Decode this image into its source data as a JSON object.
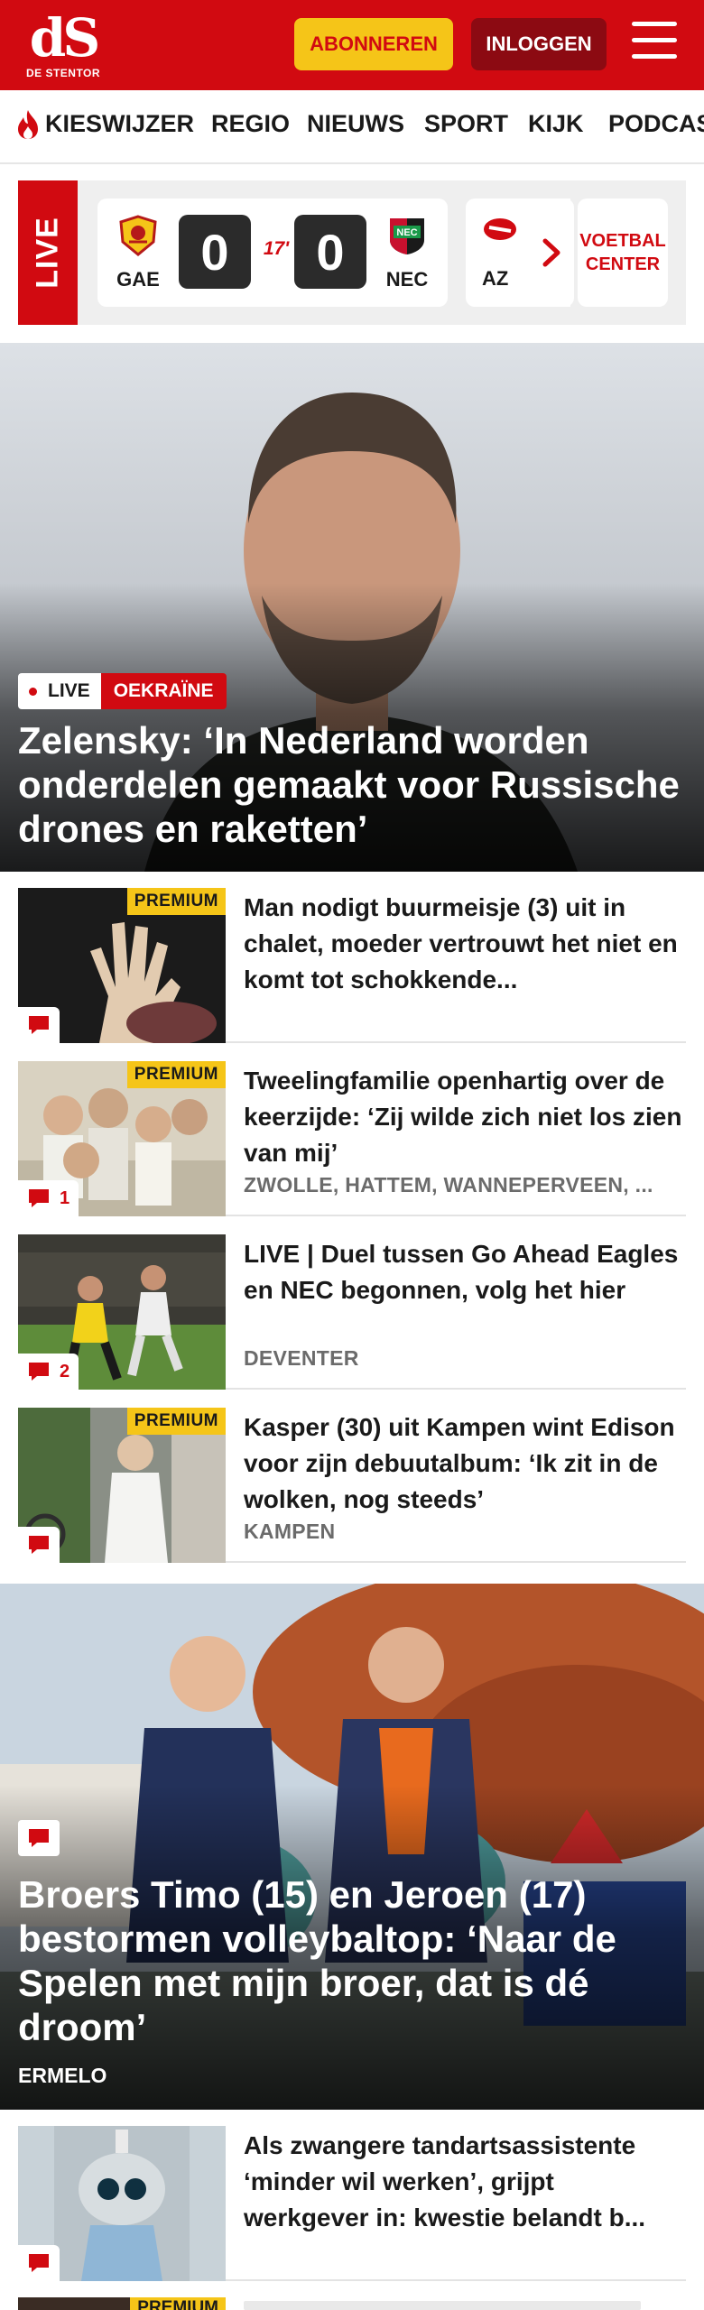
{
  "header": {
    "logo_mark": "dS",
    "logo_sub": "DE STENTOR",
    "subscribe_label": "ABONNEREN",
    "login_label": "INLOGGEN"
  },
  "nav": {
    "items": [
      "KIESWIJZER",
      "REGIO",
      "NIEUWS",
      "SPORT",
      "KIJK",
      "PODCAS"
    ]
  },
  "live": {
    "tab_label": "LIVE",
    "match": {
      "home_abbr": "GAE",
      "home_score": "0",
      "minute": "17'",
      "away_score": "0",
      "away_abbr": "NEC"
    },
    "next_match_abbr": "AZ",
    "football_center": [
      "VOETBAL",
      "CENTER"
    ]
  },
  "hero": {
    "live_label": "LIVE",
    "tag": "OEKRAÏNE",
    "title": "Zelensky: ‘In Nederland worden onderdelen gemaakt voor Russische drones en raketten’"
  },
  "articles": [
    {
      "premium": "PREMIUM",
      "comments": "",
      "title": "Man nodigt buurmeisje (3) uit in chalet, moeder vertrouwt het niet en komt tot schokkende...",
      "location": ""
    },
    {
      "premium": "PREMIUM",
      "comments": "1",
      "title": "Tweelingfamilie openhartig over de keerzijde: ‘Zij wilde zich niet los zien van mij’",
      "location": "ZWOLLE, HATTEM, WANNEPERVEEN, ..."
    },
    {
      "premium": "",
      "comments": "2",
      "title": "LIVE | Duel tussen Go Ahead Eagles en NEC begonnen, volg het hier",
      "location": "DEVENTER"
    },
    {
      "premium": "PREMIUM",
      "comments": "",
      "title": "Kasper (30) uit Kampen wint Edison voor zijn debuutalbum: ‘Ik zit in de wolken, nog steeds’",
      "location": "KAMPEN"
    }
  ],
  "hero2": {
    "title": "Broers Timo (15) en Jeroen (17) bestormen volleybaltop: ‘Naar de Spelen met mijn broer, dat is dé droom’",
    "location": "ERMELO"
  },
  "article_last": {
    "comments": "",
    "title": "Als zwangere tandartsassistente ‘minder wil werken’, grijpt werkgever in: kwestie belandt b..."
  },
  "article_peek": {
    "premium": "PREMIUM"
  },
  "colors": {
    "brand_red": "#d10a11",
    "premium_yellow": "#f5c518",
    "login_dark_red": "#8c0a12"
  }
}
